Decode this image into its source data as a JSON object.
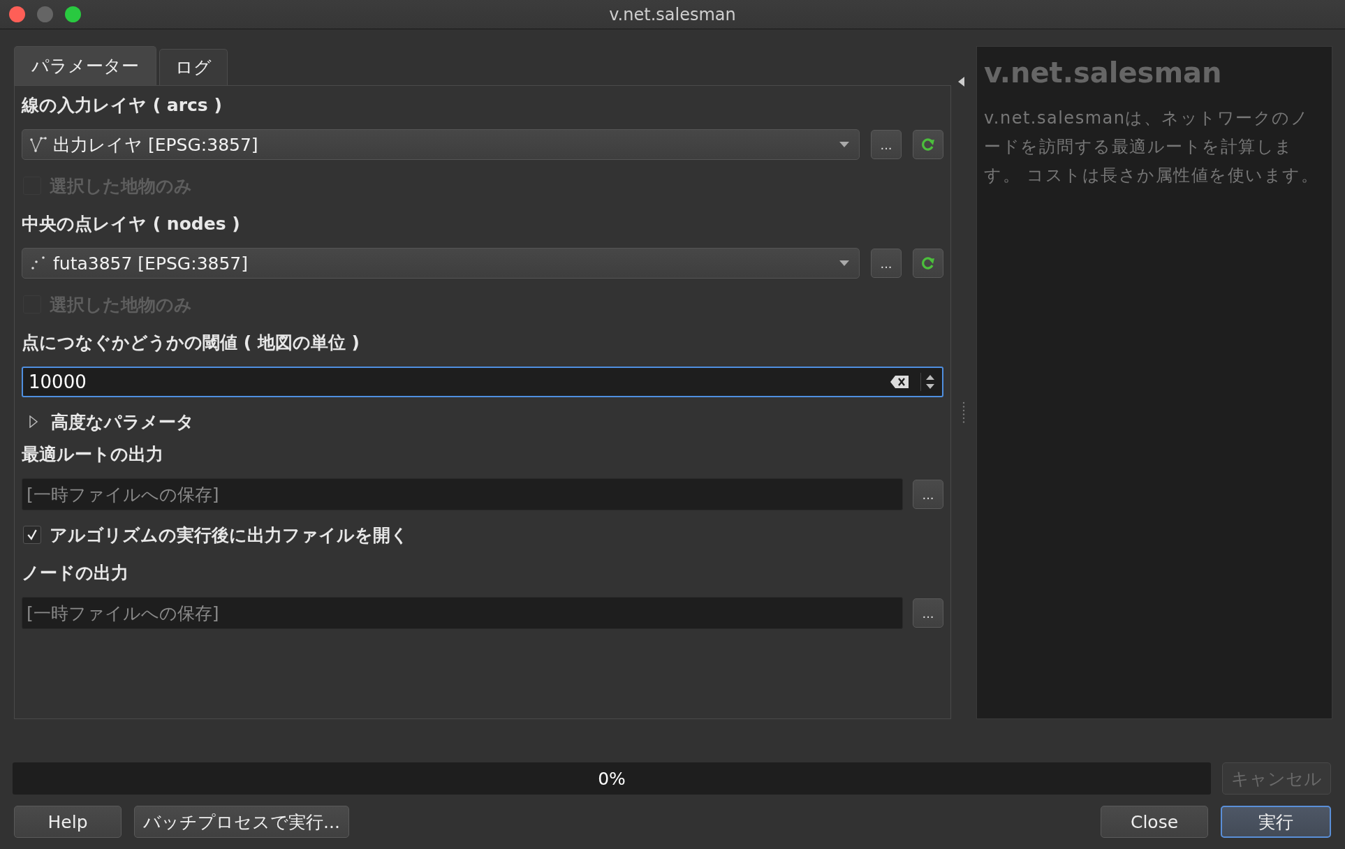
{
  "window": {
    "title": "v.net.salesman"
  },
  "tabs": [
    {
      "label": "パラメーター",
      "selected": true
    },
    {
      "label": "ログ",
      "selected": false
    }
  ],
  "parameters": [
    {
      "kind": "label",
      "text": "線の入力レイヤ ( arcs )"
    },
    {
      "kind": "line_layer",
      "value": "出力レイヤ [EPSG:3857]",
      "browse": "..."
    },
    {
      "kind": "checkbox",
      "label": "選択した地物のみ",
      "checked": false,
      "disabled": true
    },
    {
      "kind": "label",
      "text": "中央の点レイヤ ( nodes )"
    },
    {
      "kind": "point_layer",
      "value": "futa3857 [EPSG:3857]",
      "browse": "..."
    },
    {
      "kind": "checkbox",
      "label": "選択した地物のみ",
      "checked": false,
      "disabled": true
    },
    {
      "kind": "label",
      "text": "点につなぐかどうかの閾値 ( 地図の単位 )"
    },
    {
      "kind": "number",
      "value": "10000",
      "focused": true
    },
    {
      "kind": "group",
      "label": "高度なパラメータ",
      "expanded": false
    },
    {
      "kind": "label",
      "text": "最適ルートの出力"
    },
    {
      "kind": "output",
      "placeholder": "[一時ファイルへの保存]",
      "browse": "..."
    },
    {
      "kind": "checkbox",
      "label": "アルゴリズムの実行後に出力ファイルを開く",
      "checked": true,
      "disabled": false
    },
    {
      "kind": "label",
      "text": "ノードの出力"
    },
    {
      "kind": "output",
      "placeholder": "[一時ファイルへの保存]",
      "browse": "..."
    }
  ],
  "help": {
    "title": "v.net.salesman",
    "description": "v.net.salesmanは、ネットワークのノードを訪問する最適ルートを計算します。 コストは長さか属性値を使います。"
  },
  "progress": {
    "level": 0,
    "reading": "0%"
  },
  "cancel_button": {
    "label": "キャンセル",
    "disabled": true
  },
  "left_buttons": [
    {
      "label": "Help",
      "primary": false
    },
    {
      "label": "バッチプロセスで実行...",
      "primary": false
    }
  ],
  "right_buttons": [
    {
      "label": "Close",
      "primary": false
    },
    {
      "label": "実行",
      "primary": true
    }
  ]
}
